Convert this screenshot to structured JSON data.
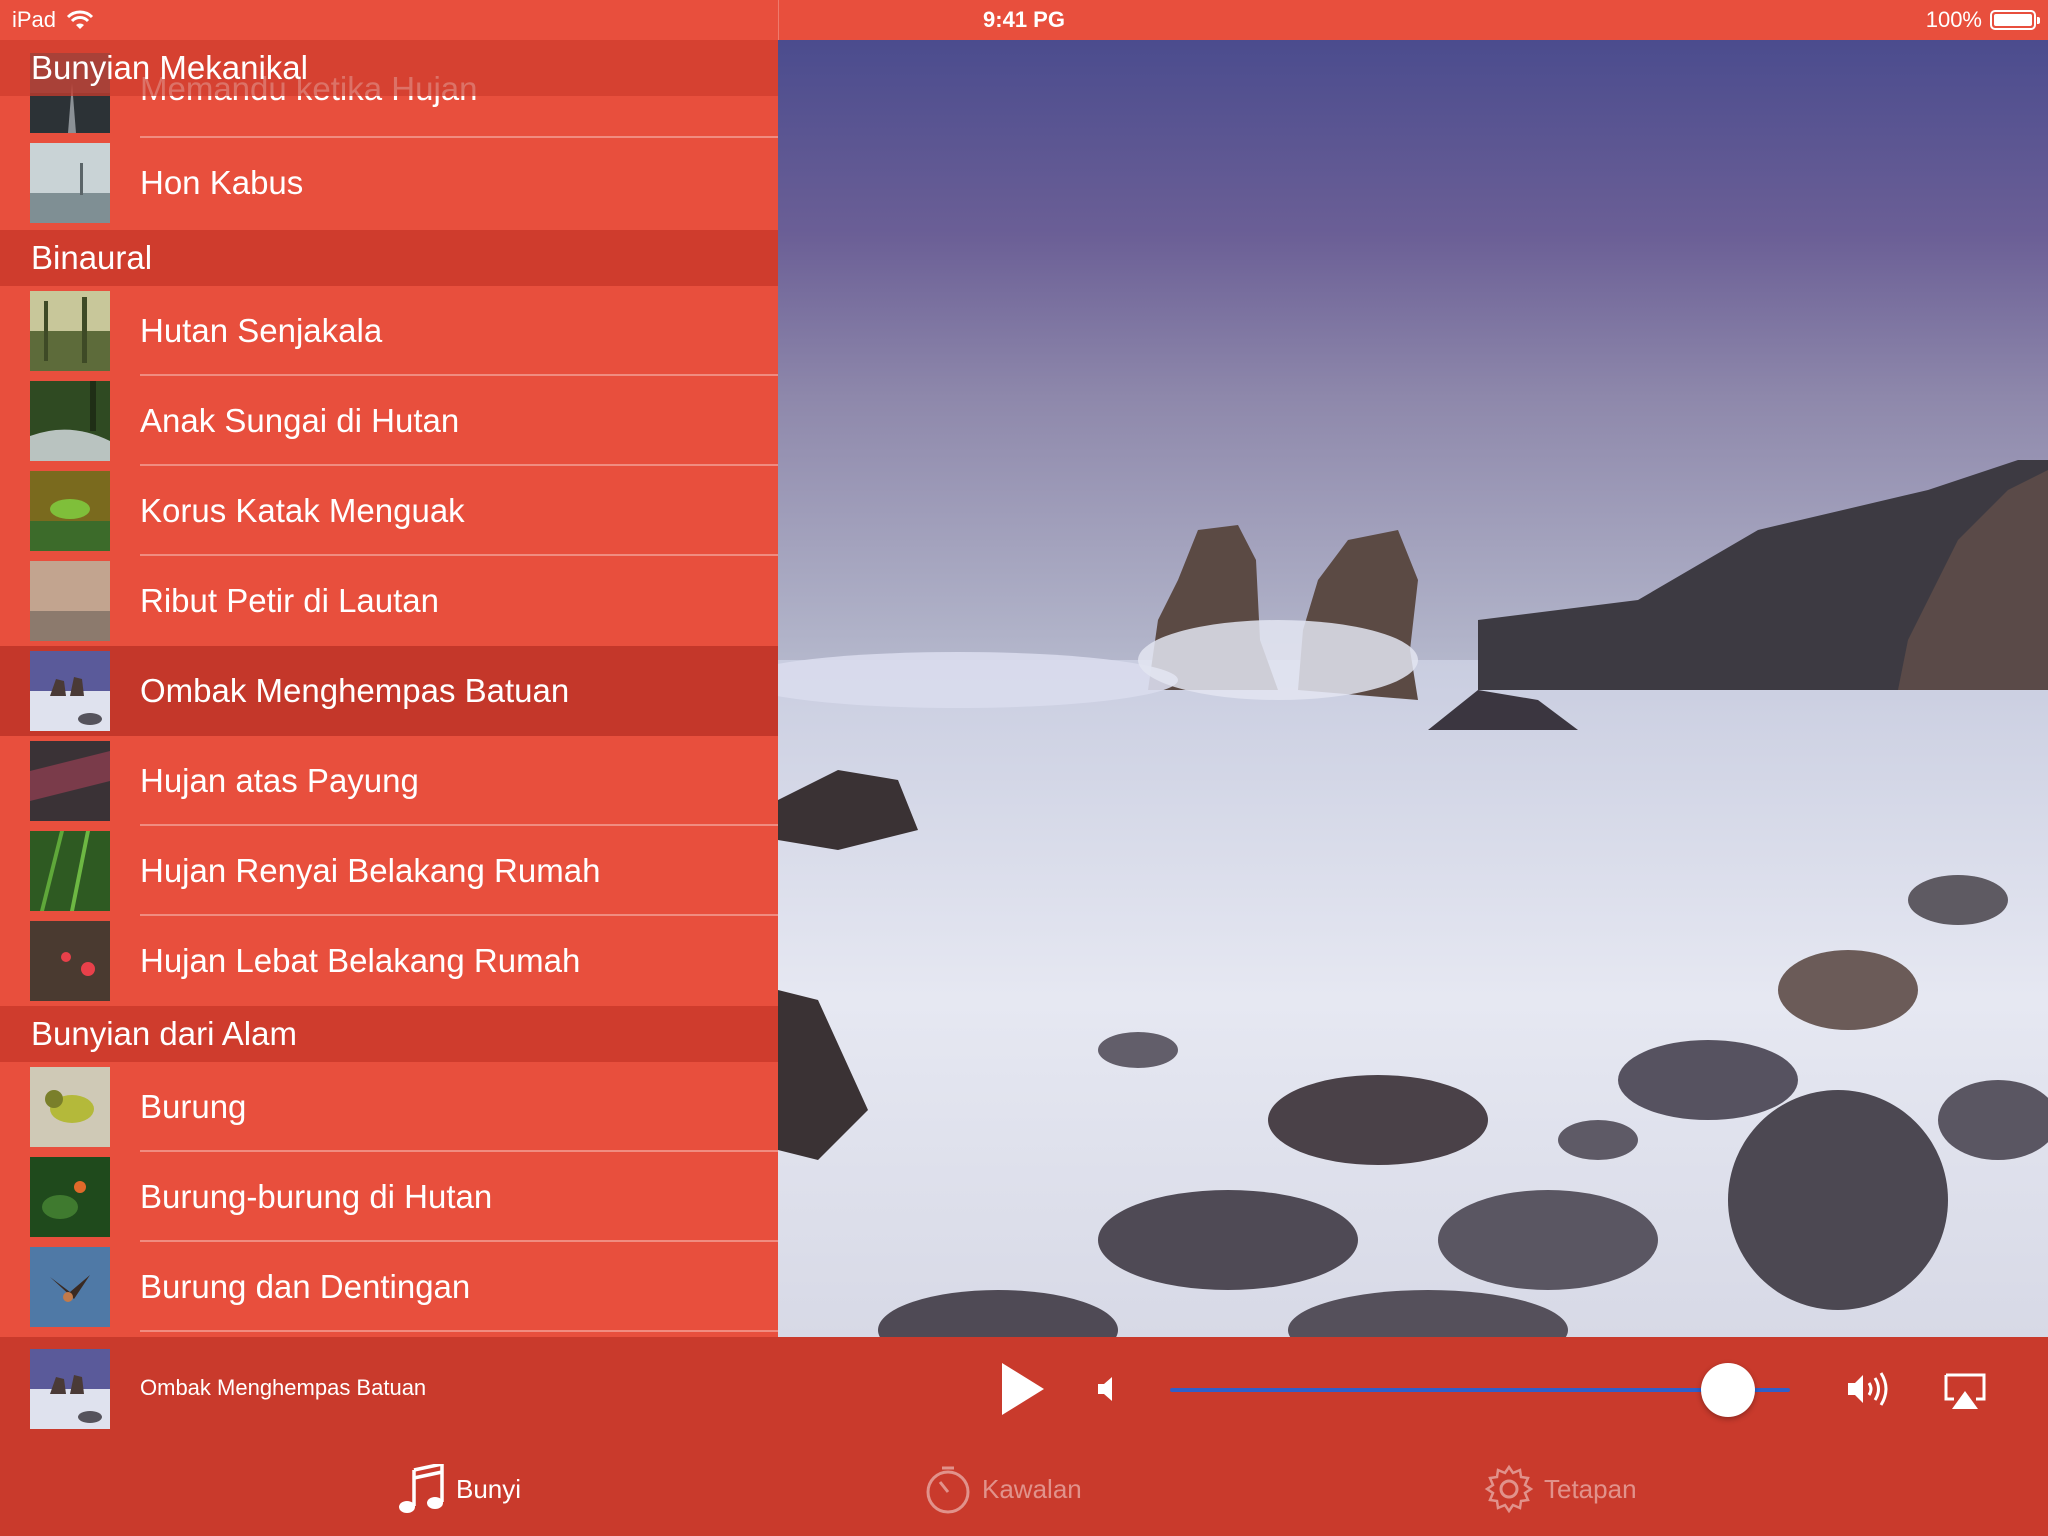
{
  "status_bar": {
    "device": "iPad",
    "time": "9:41 PG",
    "battery": "100%"
  },
  "sections": [
    {
      "title": "Bunyian Mekanikal",
      "items": [
        {
          "label": "Memandu ketika Hujan"
        },
        {
          "label": "Hon Kabus"
        }
      ]
    },
    {
      "title": "Binaural",
      "items": [
        {
          "label": "Hutan Senjakala"
        },
        {
          "label": "Anak Sungai di Hutan"
        },
        {
          "label": "Korus Katak Menguak"
        },
        {
          "label": "Ribut Petir di Lautan"
        },
        {
          "label": "Ombak Menghempas Batuan",
          "selected": true
        },
        {
          "label": "Hujan atas Payung"
        },
        {
          "label": "Hujan Renyai Belakang Rumah"
        },
        {
          "label": "Hujan Lebat Belakang Rumah"
        }
      ]
    },
    {
      "title": "Bunyian dari Alam",
      "items": [
        {
          "label": "Burung"
        },
        {
          "label": "Burung-burung di Hutan"
        },
        {
          "label": "Burung dan Dentingan"
        }
      ]
    }
  ],
  "player": {
    "now_playing": "Ombak Menghempas Batuan",
    "volume": 0.9
  },
  "tabs": [
    {
      "label": "Bunyi",
      "icon": "music-note-icon",
      "active": true
    },
    {
      "label": "Kawalan",
      "icon": "timer-icon",
      "active": false
    },
    {
      "label": "Tetapan",
      "icon": "gear-icon",
      "active": false
    }
  ],
  "colors": {
    "accent": "#e84f3d",
    "section_header": "#cf3c2d",
    "player_bar": "#c93a2c",
    "slider": "#2f5fc9"
  }
}
